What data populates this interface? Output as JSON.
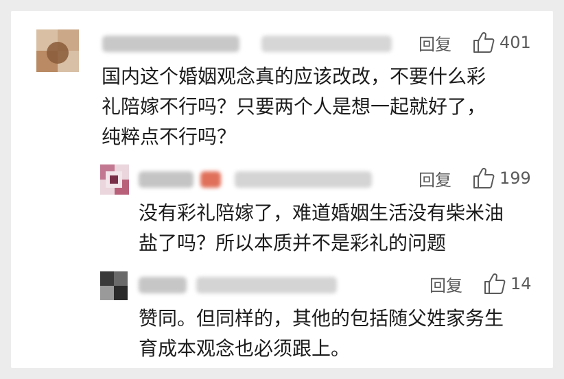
{
  "comments": [
    {
      "reply_label": "回复",
      "likes": "401",
      "text": "国内这个婚姻观念真的应该改改，不要什么彩\n礼陪嫁不行吗？只要两个人是想一起就好了，\n纯粹点不行吗？",
      "avatar_colors": [
        "#c9a98a",
        "#8a5a38",
        "#e8d6c2"
      ]
    },
    {
      "reply_label": "回复",
      "likes": "199",
      "text": "没有彩礼陪嫁了，难道婚姻生活没有柴米油\n盐了吗？所以本质并不是彩礼的问题",
      "avatar_colors": [
        "#b8607a",
        "#ead6dc",
        "#7a2f48"
      ]
    },
    {
      "reply_label": "回复",
      "likes": "14",
      "text": "赞同。但同样的，其他的包括随父姓家务生\n育成本观念也必须跟上。",
      "avatar_colors": [
        "#2a2a2a",
        "#cfcfcf",
        "#6a6a6a"
      ]
    }
  ],
  "icons": {
    "like": "thumbs-up-icon"
  }
}
